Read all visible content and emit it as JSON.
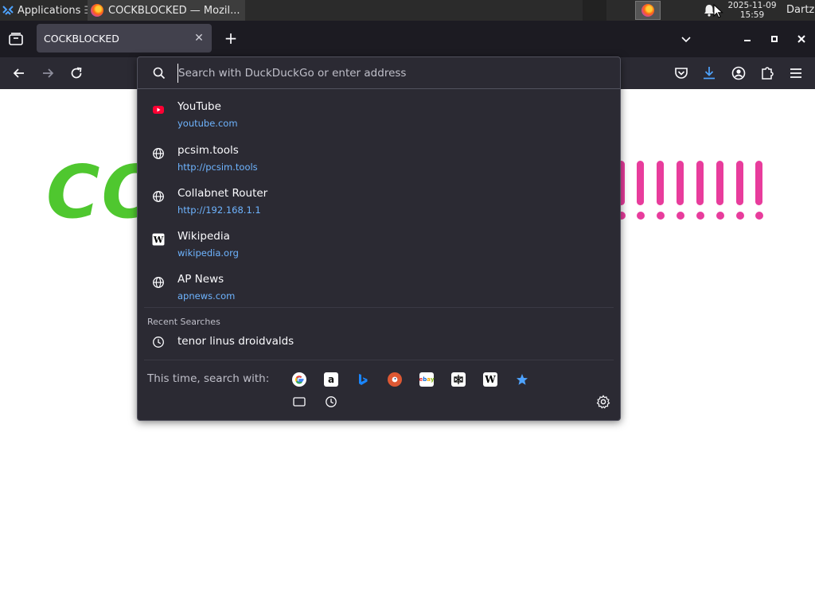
{
  "taskbar": {
    "applications_label": "Applications",
    "task_title": "COCKBLOCKED — Mozil...",
    "clock_date": "2025-11-09",
    "clock_time": "15:59",
    "user": "Dartz"
  },
  "tabs": [
    {
      "title": "COCKBLOCKED"
    }
  ],
  "page": {
    "headline_visible": "CO"
  },
  "urlbar": {
    "placeholder": "Search with DuckDuckGo or enter address",
    "results": [
      {
        "title": "YouTube",
        "url": "youtube.com",
        "icon": "youtube-icon"
      },
      {
        "title": "pcsim.tools",
        "url": "http://pcsim.tools",
        "icon": "globe-icon"
      },
      {
        "title": "Collabnet Router",
        "url": "http://192.168.1.1",
        "icon": "globe-icon"
      },
      {
        "title": "Wikipedia",
        "url": "wikipedia.org",
        "icon": "wikipedia-icon"
      },
      {
        "title": "AP News",
        "url": "apnews.com",
        "icon": "globe-icon"
      }
    ],
    "recent_searches_label": "Recent Searches",
    "recent_searches": [
      {
        "title": "tenor linus droidvalds"
      }
    ],
    "oneoff_label": "This time, search with:",
    "engines": [
      {
        "name": "google-icon"
      },
      {
        "name": "amazon-icon"
      },
      {
        "name": "bing-icon"
      },
      {
        "name": "duckduckgo-icon"
      },
      {
        "name": "ebay-icon"
      },
      {
        "name": "perplexity-icon"
      },
      {
        "name": "wikipedia-icon"
      },
      {
        "name": "bookmarks-icon"
      },
      {
        "name": "tabs-icon"
      },
      {
        "name": "history-icon"
      }
    ]
  },
  "colors": {
    "accent_blue": "#6eb4ff",
    "headline_green": "#4fc72f",
    "exclamation_pink": "#e83c9c",
    "panel_bg": "#2b2a33"
  }
}
